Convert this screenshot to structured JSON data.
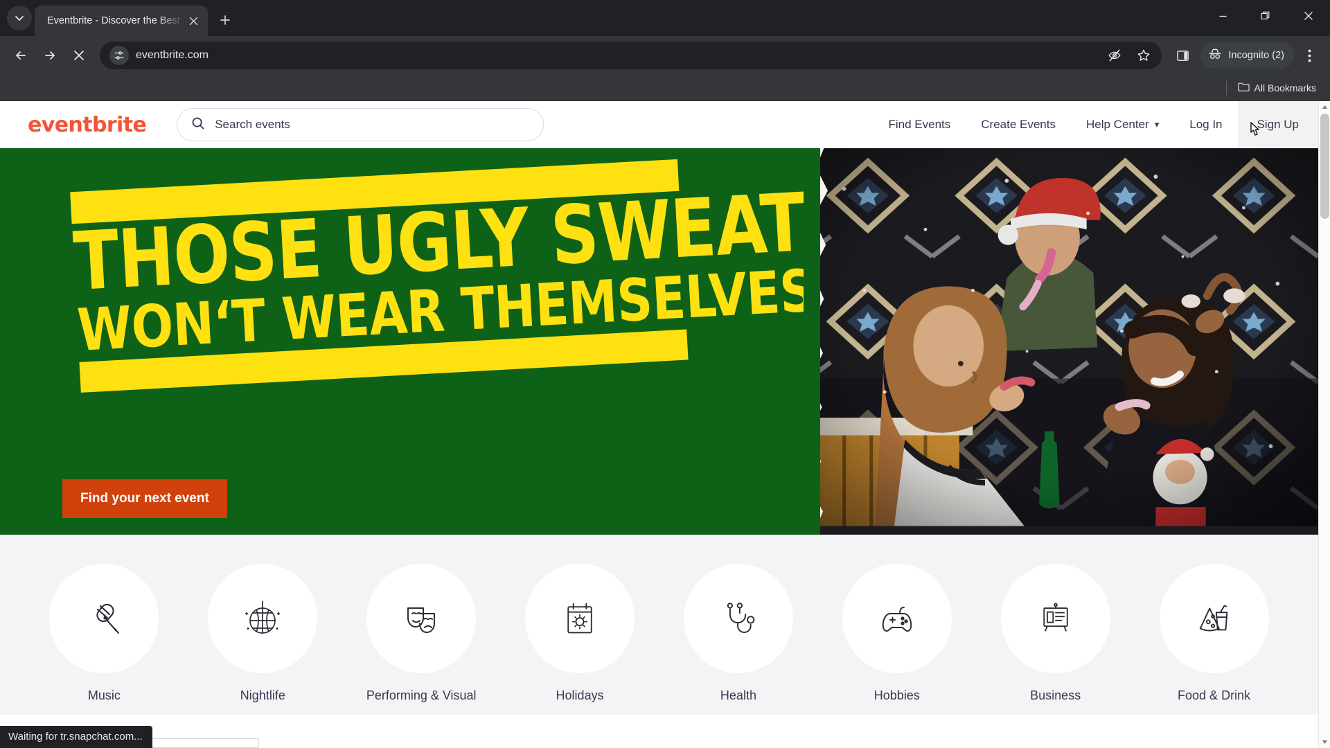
{
  "browser": {
    "tab": {
      "title": "Eventbrite - Discover the Best",
      "close_label": "×"
    },
    "newtab_label": "+",
    "toolbar": {
      "back_icon": "back-arrow-icon",
      "forward_icon": "forward-arrow-icon",
      "stop_icon": "stop-loading-icon",
      "site_settings_icon": "site-settings-icon",
      "url": "eventbrite.com",
      "tracking_protection_icon": "eye-off-icon",
      "bookmark_icon": "star-icon",
      "sidepanel_icon": "side-panel-icon",
      "profile_label": "Incognito (2)",
      "profile_icon": "incognito-icon",
      "menu_icon": "three-dot-menu-icon"
    },
    "bookmarks": {
      "all_label": "All Bookmarks",
      "folder_icon": "folder-icon"
    },
    "window": {
      "minimize": "minimize-icon",
      "maximize": "restore-icon",
      "close": "close-icon"
    },
    "status_text": "Waiting for tr.snapchat.com..."
  },
  "site": {
    "logo": "eventbrite",
    "search": {
      "placeholder": "Search events",
      "icon": "search-icon"
    },
    "nav": [
      {
        "label": "Find Events",
        "name": "nav-find-events"
      },
      {
        "label": "Create Events",
        "name": "nav-create-events"
      },
      {
        "label": "Help Center",
        "name": "nav-help-center",
        "caret": "▾"
      },
      {
        "label": "Log In",
        "name": "nav-log-in"
      },
      {
        "label": "Sign Up",
        "name": "nav-sign-up"
      }
    ],
    "hero": {
      "headline_line1": "THOSE UGLY SWEATERS",
      "headline_line2": "WON‘T WEAR THEMSELVES",
      "cta_label": "Find your next event",
      "bg_color": "#0d6217",
      "text_color": "#ffe011",
      "cta_color": "#d1410c"
    },
    "categories": [
      {
        "label": "Music",
        "icon": "microphone-icon"
      },
      {
        "label": "Nightlife",
        "icon": "disco-ball-icon"
      },
      {
        "label": "Performing & Visual",
        "icon": "theater-masks-icon"
      },
      {
        "label": "Holidays",
        "icon": "calendar-sun-icon"
      },
      {
        "label": "Health",
        "icon": "stethoscope-icon"
      },
      {
        "label": "Hobbies",
        "icon": "game-controller-icon"
      },
      {
        "label": "Business",
        "icon": "presentation-board-icon"
      },
      {
        "label": "Food & Drink",
        "icon": "pizza-drink-icon"
      }
    ],
    "colors": {
      "brand": "#f05537",
      "nav_text": "#39364f",
      "section_bg": "#f3f4f6"
    }
  }
}
